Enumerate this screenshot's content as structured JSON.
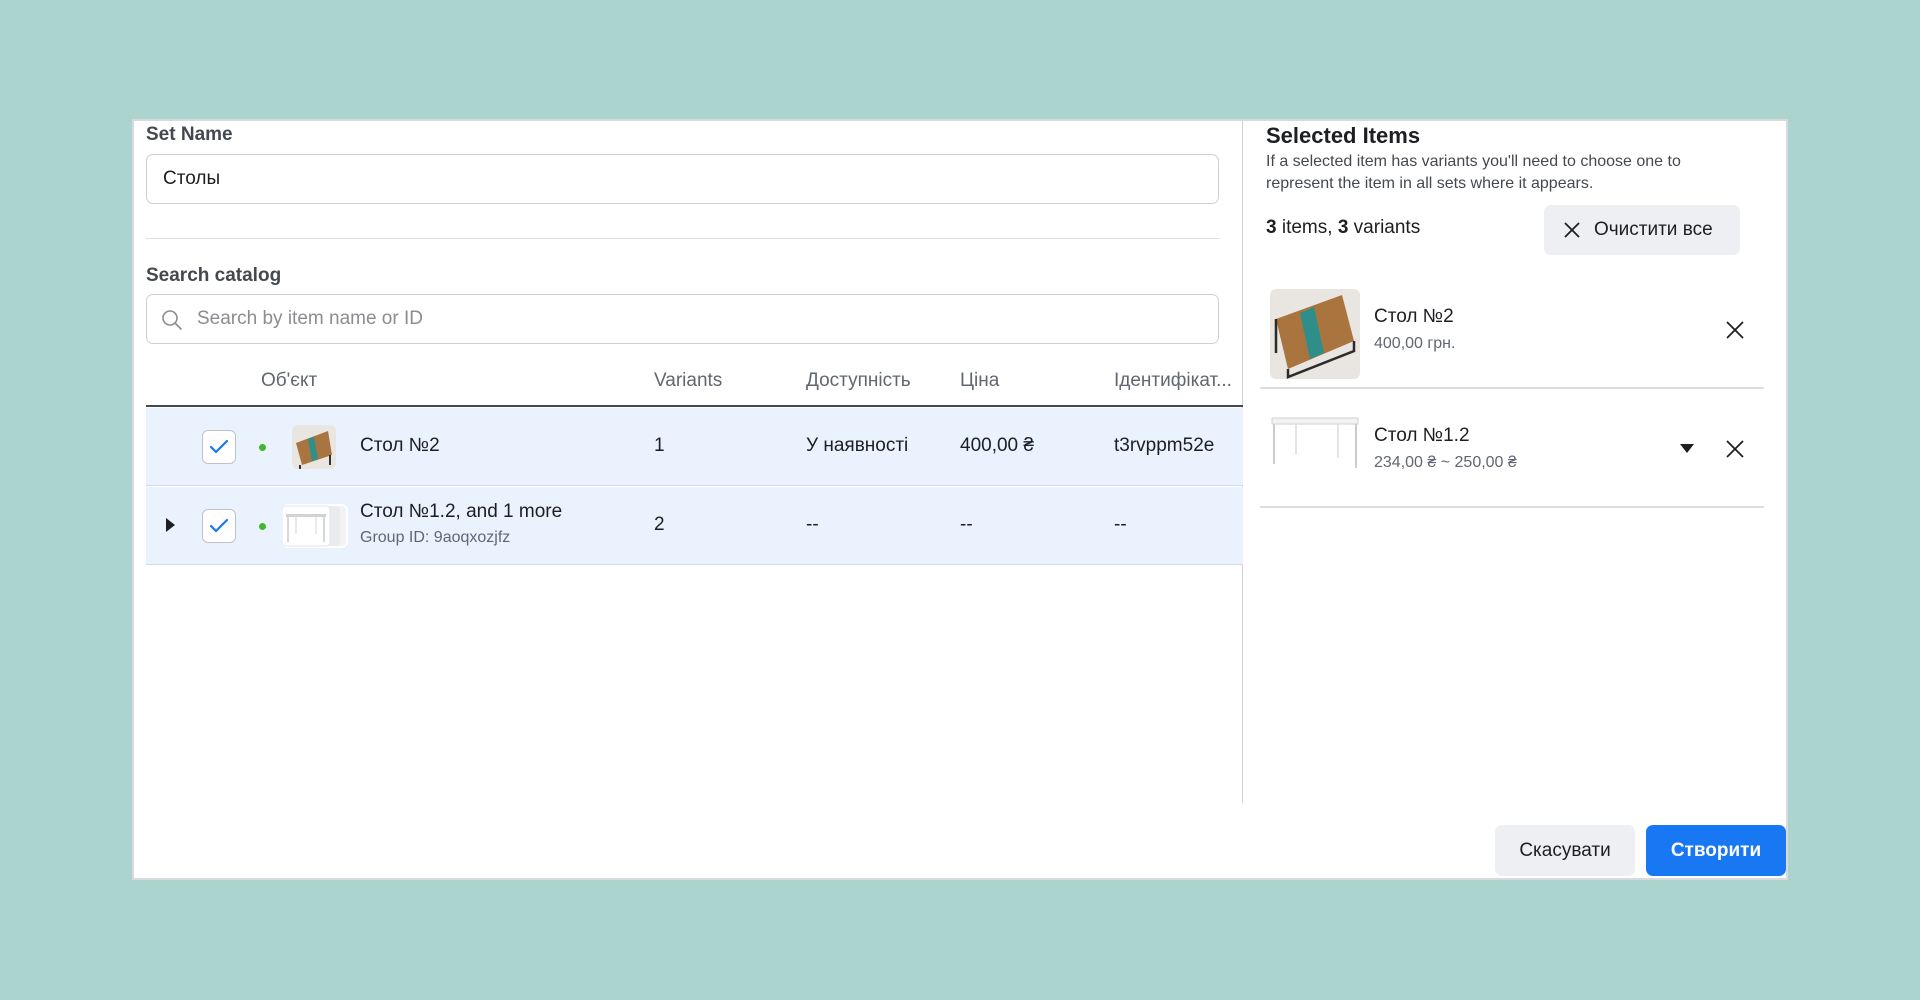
{
  "form": {
    "set_name_label": "Set Name",
    "set_name_value": "Столы",
    "search_label": "Search catalog",
    "search_placeholder": "Search by item name or ID"
  },
  "table": {
    "headers": [
      "Об'єкт",
      "Variants",
      "Доступність",
      "Ціна",
      "Ідентифікат..."
    ],
    "rows": [
      {
        "checked": true,
        "name": "Стол №2",
        "subtitle": "",
        "variants": "1",
        "availability": "У наявності",
        "price": "400,00 ₴",
        "id": "t3rvppm52e"
      },
      {
        "checked": true,
        "expandable": true,
        "name": "Стол №1.2, and 1 more",
        "subtitle": "Group ID: 9aoqxozjfz",
        "variants": "2",
        "availability": "--",
        "price": "--",
        "id": "--"
      }
    ]
  },
  "selected": {
    "title": "Selected Items",
    "description": "If a selected item has variants you'll need to choose one to represent the item in all sets where it appears.",
    "items_count": "3",
    "items_word": " items, ",
    "variants_count": "3",
    "variants_word": " variants",
    "clear_all_label": "Очистити все",
    "items": [
      {
        "name": "Стол №2",
        "price": "400,00 грн."
      },
      {
        "name": "Стол №1.2",
        "price": "234,00 ₴ ~ 250,00 ₴"
      }
    ]
  },
  "footer": {
    "cancel_label": "Скасувати",
    "create_label": "Створити"
  },
  "colors": {
    "background": "#acd4cf",
    "primary": "#1877f2",
    "row_selected": "#eaf3fd",
    "status_dot": "#42b72a"
  }
}
